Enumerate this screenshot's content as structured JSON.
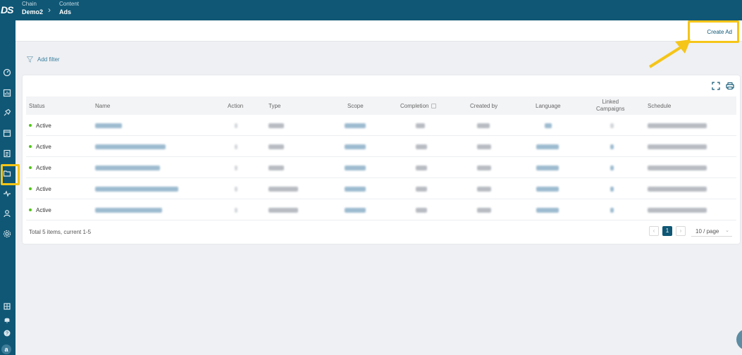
{
  "app": {
    "logo_text": "DS",
    "avatar_letter": "a"
  },
  "breadcrumb": [
    {
      "label": "Chain",
      "value": "Demo2"
    },
    {
      "label": "Content",
      "value": "Ads"
    }
  ],
  "toolbar": {
    "create_label": "Create Ad"
  },
  "filter": {
    "label": "Add filter"
  },
  "table": {
    "columns": {
      "status": "Status",
      "name": "Name",
      "action": "Action",
      "type": "Type",
      "scope": "Scope",
      "completion": "Completion",
      "created_by": "Created by",
      "language": "Language",
      "linked_1": "Linked",
      "linked_2": "Campaigns",
      "schedule": "Schedule"
    },
    "rows": [
      {
        "status": "Active"
      },
      {
        "status": "Active"
      },
      {
        "status": "Active"
      },
      {
        "status": "Active"
      },
      {
        "status": "Active"
      }
    ]
  },
  "pagination": {
    "summary": "Total 5 items, current 1-5",
    "current_page": "1",
    "prev": "‹",
    "next": "›",
    "page_size": "10 / page"
  },
  "colors": {
    "brand": "#0f5775",
    "highlight": "#f5c518",
    "active_status": "#52c41a"
  },
  "sidebar_icons": [
    "dashboard-icon",
    "chart-icon",
    "rocket-icon",
    "calendar-icon",
    "report-icon",
    "folder-icon",
    "activity-icon",
    "user-icon",
    "settings-icon",
    "grid-icon",
    "bell-icon",
    "help-icon"
  ]
}
